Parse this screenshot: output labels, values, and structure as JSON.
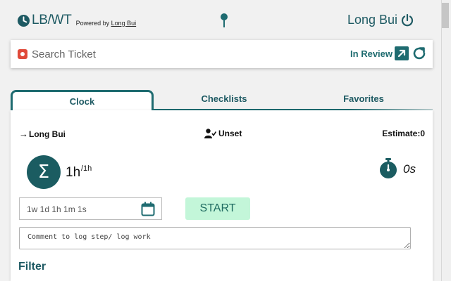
{
  "header": {
    "app_name": "LB/WT",
    "powered_prefix": "Powered by ",
    "powered_author": "Long Bui",
    "user_name": "Long Bui",
    "icons": {
      "brand": "clock-icon",
      "pin": "pin-icon",
      "logout": "power-icon"
    }
  },
  "search": {
    "placeholder": "Search Ticket",
    "status": "In Review",
    "icons": {
      "record": "record-icon",
      "open": "open-external-icon",
      "refresh": "refresh-icon"
    }
  },
  "tabs": [
    {
      "label": "Clock",
      "active": true
    },
    {
      "label": "Checklists",
      "active": false
    },
    {
      "label": "Favorites",
      "active": false
    }
  ],
  "clock": {
    "assignee_arrow": "→",
    "assignee": "Long Bui",
    "status": "Unset",
    "estimate": "Estimate:0",
    "total_symbol": "Σ",
    "total_time": "1h",
    "total_sup": "/1h",
    "timer": "0s",
    "duration_placeholder": "1w 1d 1h 1m 1s",
    "start_label": "START",
    "comment_placeholder": "Comment to log step/ log work",
    "filter_heading": "Filter"
  },
  "colors": {
    "accent": "#1e5a63",
    "accent_dark": "#1b5c61",
    "start_bg": "#c3f6d9",
    "record_red": "#e04a3a"
  }
}
